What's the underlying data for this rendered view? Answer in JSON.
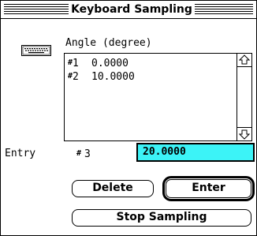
{
  "window": {
    "title": "Keyboard Sampling"
  },
  "icon": {
    "name": "keyboard-icon"
  },
  "list": {
    "label": "Angle (degree)",
    "items": [
      {
        "hash": "#",
        "index": "1",
        "value": "0.0000"
      },
      {
        "hash": "#",
        "index": "2",
        "value": "10.0000"
      }
    ]
  },
  "entry": {
    "label": "Entry",
    "hash": "#",
    "index": "3",
    "value": "20.0000",
    "field_color": "#3cf3f7"
  },
  "buttons": {
    "delete": "Delete",
    "enter": "Enter",
    "stop": "Stop Sampling"
  }
}
